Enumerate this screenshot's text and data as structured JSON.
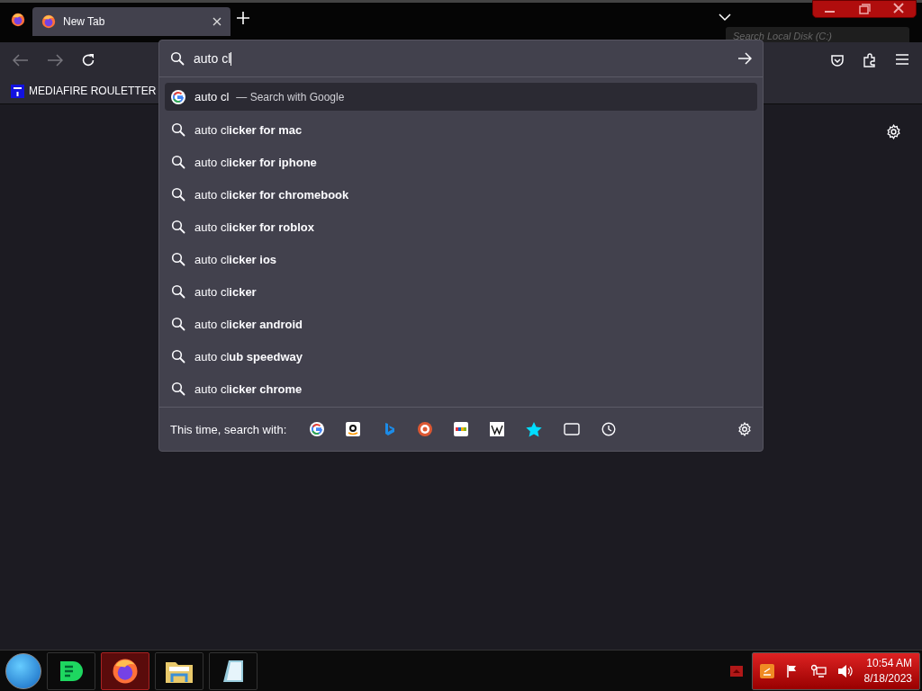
{
  "tab_strip": {
    "tabs": [
      {
        "title": "New Tab",
        "selected": true
      }
    ]
  },
  "explorer_behind": {
    "search_placeholder": "Search Local Disk (C:)"
  },
  "bookmarks": [
    {
      "label": "MEDIAFIRE ROULETTER"
    }
  ],
  "urlbar": {
    "value": "auto cl",
    "suggestions": [
      {
        "kind": "engine",
        "text": "auto cl",
        "action": "— Search with Google",
        "selected": true
      },
      {
        "kind": "suggestion",
        "text": "auto cl**icker for mac**",
        "selected": false
      },
      {
        "kind": "suggestion",
        "text": "auto cl**icker for iphone**",
        "selected": false
      },
      {
        "kind": "suggestion",
        "text": "auto cl**icker for chromebook**",
        "selected": false
      },
      {
        "kind": "suggestion",
        "text": "auto cl**icker for roblox**",
        "selected": false
      },
      {
        "kind": "suggestion",
        "text": "auto cl**icker ios**",
        "selected": false
      },
      {
        "kind": "suggestion",
        "text": "auto cl**icker**",
        "selected": false
      },
      {
        "kind": "suggestion",
        "text": "auto cl**icker android**",
        "selected": false
      },
      {
        "kind": "suggestion",
        "text": "auto cl**ub speedway**",
        "selected": false
      },
      {
        "kind": "suggestion",
        "text": "auto cl**icker chrome**",
        "selected": false
      }
    ],
    "one_off_label": "This time, search with:"
  },
  "taskbar": {
    "time": "10:54 AM",
    "date": "8/18/2023"
  }
}
